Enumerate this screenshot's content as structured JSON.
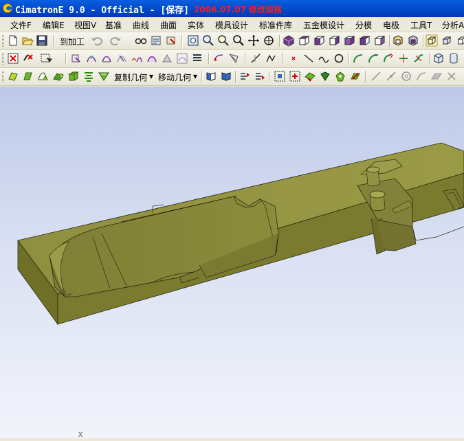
{
  "window": {
    "title": "CimatronE 9.0 - Official - [保存]",
    "title_overlay": "2006.07.07 修改规格"
  },
  "menu": [
    "文件F",
    "编辑E",
    "视图V",
    "基准",
    "曲线",
    "曲面",
    "实体",
    "模具设计",
    "标准件库",
    "五金模设计",
    "分模",
    "电极",
    "工具T",
    "分析A"
  ],
  "toolbar1": {
    "machining_label": "到加工"
  },
  "toolbar3": {
    "copy_geometry_label": "复制几何",
    "move_geometry_label": "移动几何"
  },
  "viewport": {
    "axis_label": "X",
    "model_color": "#8a8a3c"
  },
  "colors": {
    "title_bar": "#0050d8",
    "title_overlay": "#ff1a1a",
    "chrome": "#ece9d8"
  }
}
